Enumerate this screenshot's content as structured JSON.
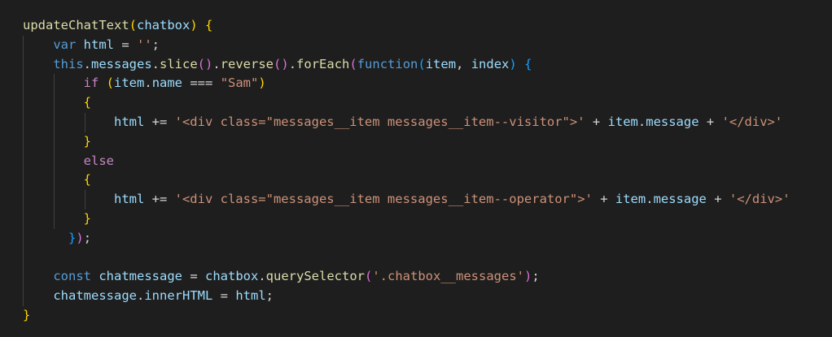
{
  "editor": {
    "theme_colors": {
      "background": "#1e1e1e",
      "function": "#dcdcaa",
      "variable": "#9cdcfe",
      "keyword": "#569cd6",
      "control": "#c586c0",
      "string": "#ce9178",
      "bracket_level_1": "#ffd700",
      "bracket_level_2": "#da70d6",
      "bracket_level_3": "#179fff"
    },
    "lines": [
      [
        [
          "fn",
          "updateChatText"
        ],
        [
          "br1",
          "("
        ],
        [
          "var",
          "chatbox"
        ],
        [
          "br1",
          ")"
        ],
        [
          "op",
          " "
        ],
        [
          "br1",
          "{"
        ]
      ],
      [
        [
          "op",
          "    "
        ],
        [
          "kw",
          "var"
        ],
        [
          "op",
          " "
        ],
        [
          "var",
          "html"
        ],
        [
          "op",
          " = "
        ],
        [
          "str",
          "''"
        ],
        [
          "op",
          ";"
        ]
      ],
      [
        [
          "op",
          "    "
        ],
        [
          "kw",
          "this"
        ],
        [
          "op",
          "."
        ],
        [
          "var",
          "messages"
        ],
        [
          "op",
          "."
        ],
        [
          "fn",
          "slice"
        ],
        [
          "br2",
          "()"
        ],
        [
          "op",
          "."
        ],
        [
          "fn",
          "reverse"
        ],
        [
          "br2",
          "()"
        ],
        [
          "op",
          "."
        ],
        [
          "fn",
          "forEach"
        ],
        [
          "br2",
          "("
        ],
        [
          "kw",
          "function"
        ],
        [
          "br3",
          "("
        ],
        [
          "var",
          "item"
        ],
        [
          "op",
          ", "
        ],
        [
          "var",
          "index"
        ],
        [
          "br3",
          ")"
        ],
        [
          "op",
          " "
        ],
        [
          "br3",
          "{"
        ]
      ],
      [
        [
          "op",
          "        "
        ],
        [
          "ctl",
          "if"
        ],
        [
          "op",
          " "
        ],
        [
          "br1",
          "("
        ],
        [
          "var",
          "item"
        ],
        [
          "op",
          "."
        ],
        [
          "var",
          "name"
        ],
        [
          "op",
          " === "
        ],
        [
          "str",
          "\"Sam\""
        ],
        [
          "br1",
          ")"
        ]
      ],
      [
        [
          "op",
          "        "
        ],
        [
          "br1",
          "{"
        ]
      ],
      [
        [
          "op",
          "            "
        ],
        [
          "var",
          "html"
        ],
        [
          "op",
          " += "
        ],
        [
          "str",
          "'<div class=\"messages__item messages__item--visitor\">'"
        ],
        [
          "op",
          " + "
        ],
        [
          "var",
          "item"
        ],
        [
          "op",
          "."
        ],
        [
          "var",
          "message"
        ],
        [
          "op",
          " + "
        ],
        [
          "str",
          "'</div>'"
        ]
      ],
      [
        [
          "op",
          "        "
        ],
        [
          "br1",
          "}"
        ]
      ],
      [
        [
          "op",
          "        "
        ],
        [
          "ctl",
          "else"
        ]
      ],
      [
        [
          "op",
          "        "
        ],
        [
          "br1",
          "{"
        ]
      ],
      [
        [
          "op",
          "            "
        ],
        [
          "var",
          "html"
        ],
        [
          "op",
          " += "
        ],
        [
          "str",
          "'<div class=\"messages__item messages__item--operator\">'"
        ],
        [
          "op",
          " + "
        ],
        [
          "var",
          "item"
        ],
        [
          "op",
          "."
        ],
        [
          "var",
          "message"
        ],
        [
          "op",
          " + "
        ],
        [
          "str",
          "'</div>'"
        ]
      ],
      [
        [
          "op",
          "        "
        ],
        [
          "br1",
          "}"
        ]
      ],
      [
        [
          "op",
          "      "
        ],
        [
          "br3",
          "}"
        ],
        [
          "br2",
          ")"
        ],
        [
          "op",
          ";"
        ]
      ],
      [],
      [
        [
          "op",
          "    "
        ],
        [
          "kw",
          "const"
        ],
        [
          "op",
          " "
        ],
        [
          "var",
          "chatmessage"
        ],
        [
          "op",
          " = "
        ],
        [
          "var",
          "chatbox"
        ],
        [
          "op",
          "."
        ],
        [
          "fn",
          "querySelector"
        ],
        [
          "br2",
          "("
        ],
        [
          "str",
          "'.chatbox__messages'"
        ],
        [
          "br2",
          ")"
        ],
        [
          "op",
          ";"
        ]
      ],
      [
        [
          "op",
          "    "
        ],
        [
          "var",
          "chatmessage"
        ],
        [
          "op",
          "."
        ],
        [
          "var",
          "innerHTML"
        ],
        [
          "op",
          " = "
        ],
        [
          "var",
          "html"
        ],
        [
          "op",
          ";"
        ]
      ],
      [
        [
          "br1",
          "}"
        ]
      ]
    ],
    "guides": [
      [],
      [
        1
      ],
      [
        1
      ],
      [
        1,
        2
      ],
      [
        1,
        2
      ],
      [
        1,
        2,
        3
      ],
      [
        1,
        2
      ],
      [
        1,
        2
      ],
      [
        1,
        2
      ],
      [
        1,
        2,
        3
      ],
      [
        1,
        2
      ],
      [
        1
      ],
      [
        1
      ],
      [
        1
      ],
      [
        1
      ],
      []
    ]
  }
}
